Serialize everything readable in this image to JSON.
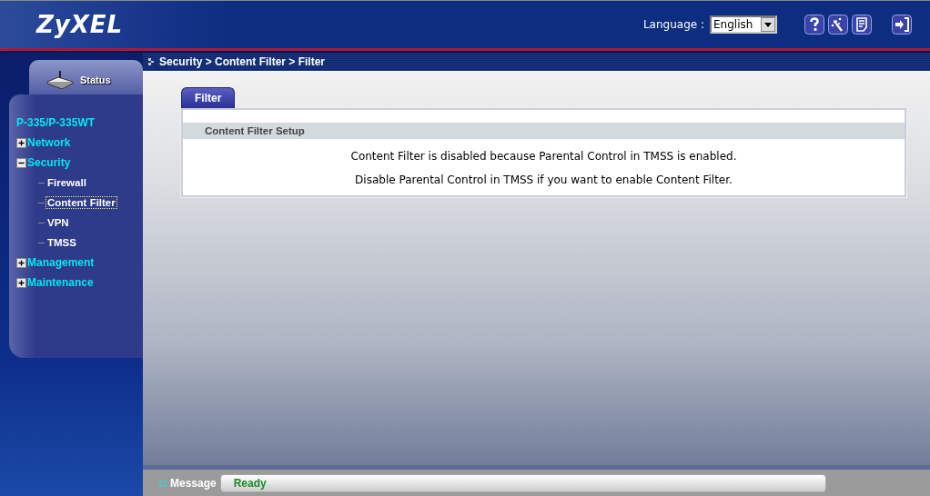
{
  "header": {
    "logo": "ZyXEL",
    "language_label": "Language :",
    "language": "English"
  },
  "sidebar": {
    "status_tab": "Status",
    "device": "P-335/P-335WT",
    "tree": [
      {
        "label": "Network",
        "expanded": false
      },
      {
        "label": "Security",
        "expanded": true,
        "children": [
          {
            "label": "Firewall",
            "selected": false
          },
          {
            "label": "Content Filter",
            "selected": true
          },
          {
            "label": "VPN",
            "selected": false
          },
          {
            "label": "TMSS",
            "selected": false
          }
        ]
      },
      {
        "label": "Management",
        "expanded": false
      },
      {
        "label": "Maintenance",
        "expanded": false
      }
    ]
  },
  "breadcrumb": "Security > Content Filter > Filter",
  "tabs": [
    {
      "label": "Filter",
      "selected": true
    }
  ],
  "panel": {
    "title": "Content Filter Setup",
    "lines": [
      "Content Filter is disabled because Parental Control in TMSS is enabled.",
      "Disable Parental Control in TMSS if you want to enable Content Filter."
    ]
  },
  "status_bar": {
    "label": "Message",
    "value": "Ready"
  }
}
